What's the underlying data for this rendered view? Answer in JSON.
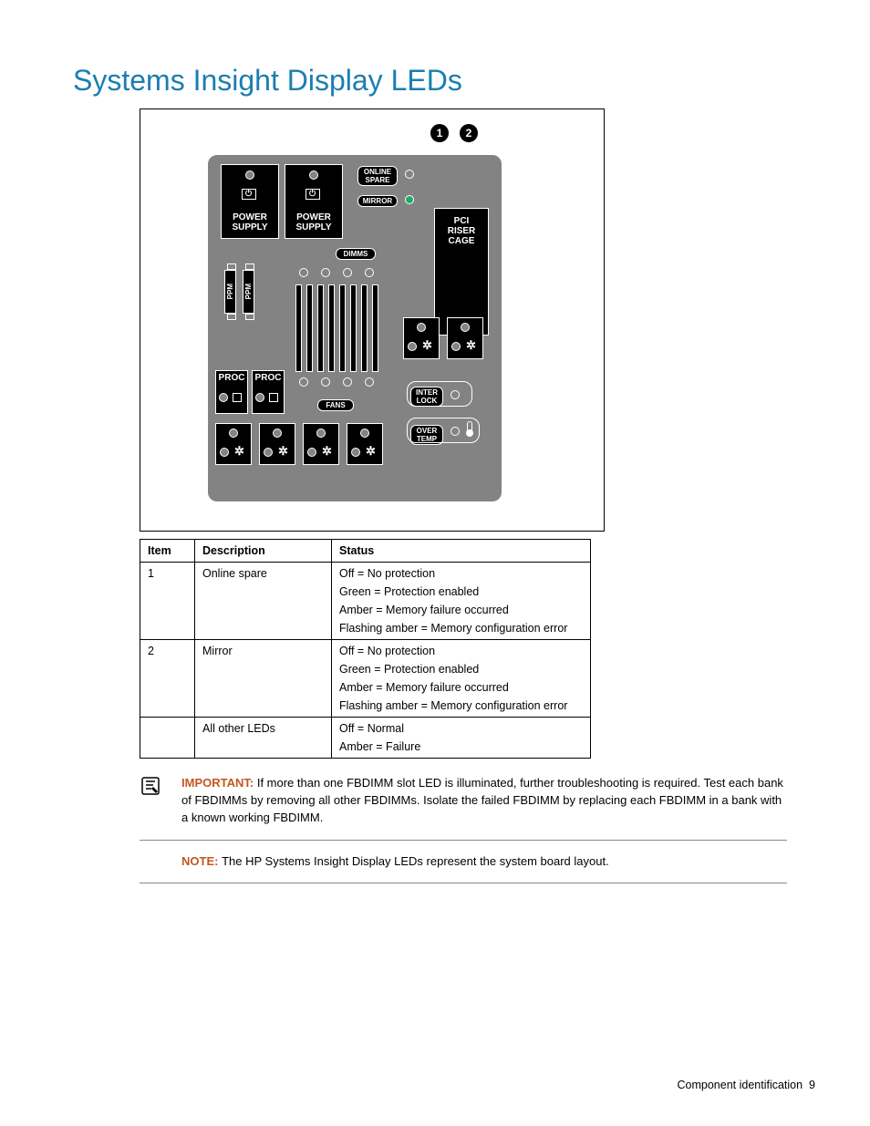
{
  "heading": "Systems Insight Display LEDs",
  "diagram": {
    "callouts": [
      "1",
      "2"
    ],
    "labels": {
      "online_spare": "ONLINE\nSPARE",
      "mirror": "MIRROR",
      "power_supply": "POWER\nSUPPLY",
      "pci_riser": "PCI\nRISER\nCAGE",
      "dimms": "DIMMS",
      "ppm": "PPM",
      "proc": "PROC",
      "fans": "FANS",
      "inter_lock": "INTER\nLOCK",
      "over_temp": "OVER\nTEMP"
    }
  },
  "table": {
    "headers": {
      "item": "Item",
      "description": "Description",
      "status": "Status"
    },
    "rows": [
      {
        "item": "1",
        "description": "Online spare",
        "status": [
          "Off = No protection",
          "Green = Protection enabled",
          "Amber = Memory failure occurred",
          "Flashing amber = Memory configuration error"
        ]
      },
      {
        "item": "2",
        "description": "Mirror",
        "status": [
          "Off = No protection",
          "Green = Protection enabled",
          "Amber = Memory failure occurred",
          "Flashing amber = Memory configuration error"
        ]
      },
      {
        "item": "",
        "description": "All other LEDs",
        "status": [
          "Off = Normal",
          "Amber = Failure"
        ]
      }
    ]
  },
  "important": {
    "label": "IMPORTANT:",
    "text": "If more than one FBDIMM slot LED is illuminated, further troubleshooting is required. Test each bank of FBDIMMs by removing all other FBDIMMs. Isolate the failed FBDIMM by replacing each FBDIMM in a bank with a known working FBDIMM."
  },
  "note": {
    "label": "NOTE:",
    "text": "The HP Systems Insight Display LEDs represent the system board layout."
  },
  "footer": {
    "section": "Component identification",
    "page": "9"
  }
}
